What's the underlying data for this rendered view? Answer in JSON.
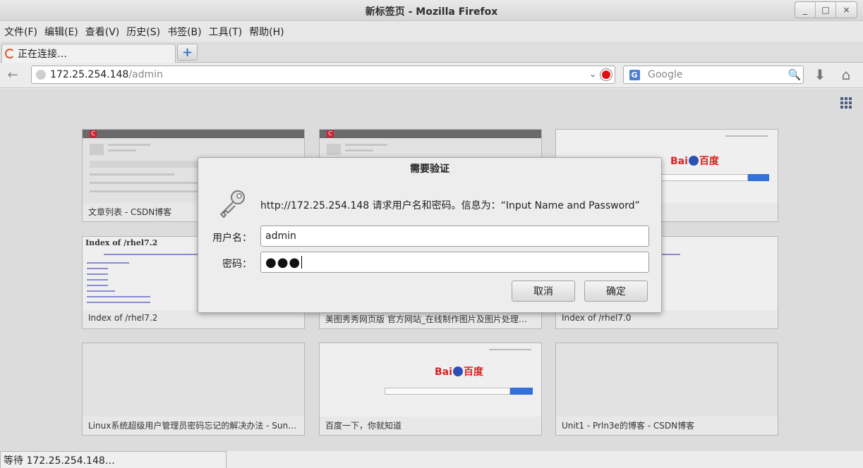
{
  "window": {
    "title": "新标签页 - Mozilla Firefox",
    "controls": [
      "_",
      "□",
      "×"
    ]
  },
  "menu": [
    "文件(F)",
    "编辑(E)",
    "查看(V)",
    "历史(S)",
    "书签(B)",
    "工具(T)",
    "帮助(H)"
  ],
  "tab": {
    "label": "正在连接…"
  },
  "newtab_icon": "+",
  "nav": {
    "back_icon": "←",
    "url_host": "172.25.254.148",
    "url_path": "/admin",
    "dropdown_icon": "⌄",
    "search_engine": "G",
    "search_placeholder": "Google",
    "search_icon": "🔍",
    "download_icon": "⬇",
    "home_icon": "⌂"
  },
  "tiles": [
    {
      "title": "文章列表 - CSDN博客",
      "thumb_kind": "csdn"
    },
    {
      "title": "",
      "thumb_kind": "csdn"
    },
    {
      "title": "",
      "thumb_kind": "baidu"
    },
    {
      "title": "Index of /rhel7.2",
      "thumb_kind": "index",
      "heading": "Index of /rhel7.2"
    },
    {
      "title": "美图秀秀网页版 官方网站_在线制作图片及图片处理…",
      "thumb_kind": "blank"
    },
    {
      "title": "Index of /rhel7.0",
      "thumb_kind": "index",
      "heading": ""
    },
    {
      "title": "Linux系统超级用户管理员密码忘记的解决办法 - Sunn…",
      "thumb_kind": "blank"
    },
    {
      "title": "百度一下，你就知道",
      "thumb_kind": "baidu"
    },
    {
      "title": "Unit1 - Prln3e的博客 - CSDN博客",
      "thumb_kind": "blank"
    }
  ],
  "dialog": {
    "title": "需要验证",
    "message": "http://172.25.254.148 请求用户名和密码。信息为：“Input Name and Password”",
    "username_label": "用户名：",
    "username_value": "admin",
    "password_label": "密码：",
    "password_mask": "●●●",
    "cancel_label": "取消",
    "ok_label": "确定"
  },
  "status": {
    "text": "等待 172.25.254.148…"
  },
  "colors": {
    "accent": "#3370d8",
    "stop": "#dd1111"
  }
}
